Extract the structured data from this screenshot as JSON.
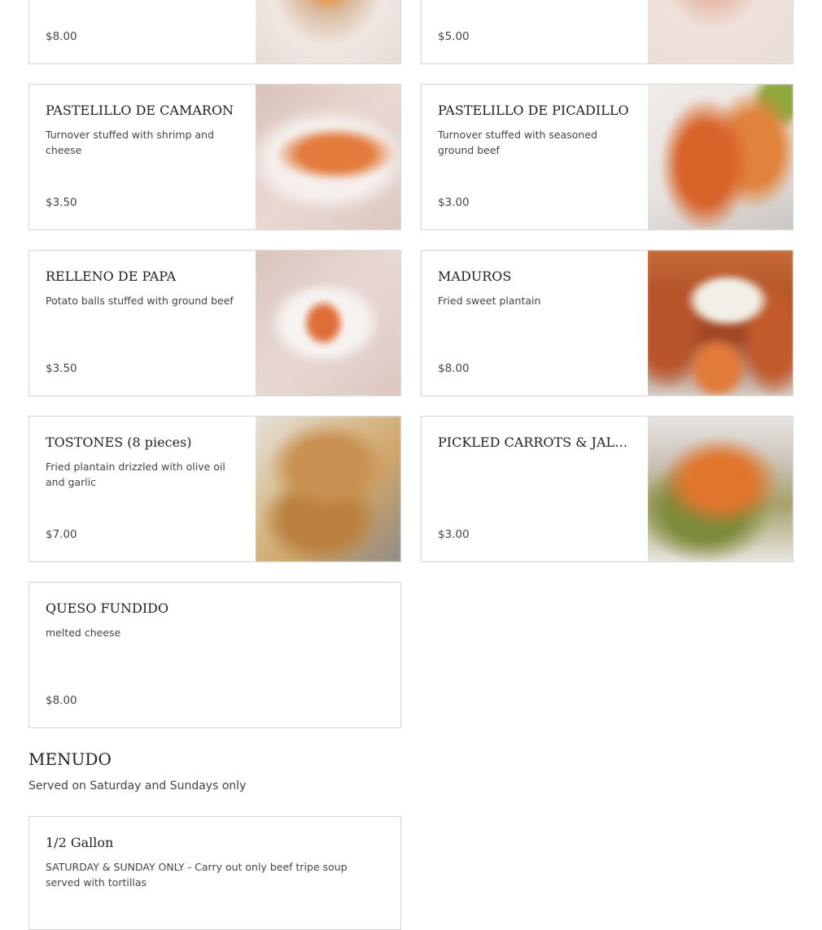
{
  "top_cards": {
    "left_price": "$8.00",
    "right_price": "$5.00"
  },
  "items": [
    {
      "name": "PASTELILLO DE CAMARON",
      "description": "Turnover stuffed with shrimp and cheese",
      "price": "$3.50",
      "image": "shrimp turnover photo"
    },
    {
      "name": "PASTELILLO DE PICADILLO",
      "description": "Turnover stuffed with seasoned ground beef",
      "price": "$3.00",
      "image": "beef turnover photo"
    },
    {
      "name": "RELLENO DE PAPA",
      "description": "Potato balls stuffed with ground beef",
      "price": "$3.50",
      "image": "potato ball photo"
    },
    {
      "name": "MADUROS",
      "description": "Fried sweet plantain",
      "price": "$8.00",
      "image": "sweet plantain photo"
    },
    {
      "name": "TOSTONES (8 pieces)",
      "description": "Fried plantain drizzled with olive oil and garlic",
      "price": "$7.00",
      "image": "tostones photo"
    },
    {
      "name": "PICKLED CARROTS & JALAP…",
      "description": "",
      "price": "$3.00",
      "image": "pickled carrots photo"
    },
    {
      "name": "QUESO FUNDIDO",
      "description": "melted cheese",
      "price": "$8.00"
    }
  ],
  "menudo_section": {
    "title": "MENUDO",
    "subtitle": "Served on Saturday and Sundays only",
    "items": [
      {
        "name": "1/2 Gallon",
        "description": "SATURDAY & SUNDAY ONLY - Carry out only beef tripe soup served with tortillas"
      }
    ]
  }
}
